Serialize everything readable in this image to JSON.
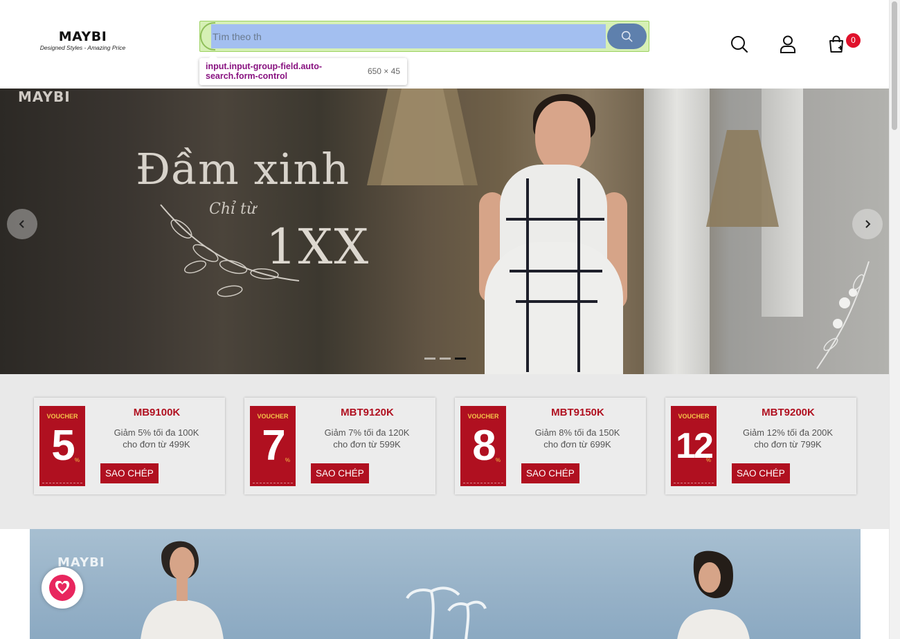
{
  "header": {
    "logo_brand": "MAYBI",
    "logo_tagline": "Designed Styles - Amazing Price",
    "search": {
      "placeholder": "Tìm theo th"
    },
    "cart_count": "0"
  },
  "devtools_tooltip": {
    "selector": "input.input-group-field.auto-search.form-control",
    "dimensions": "650 × 45"
  },
  "hero": {
    "brand": "MAYBI",
    "headline": "Đầm xinh",
    "subline": "Chỉ từ",
    "price": "1XX",
    "slides_total": 3,
    "active_slide": 3
  },
  "vouchers": [
    {
      "label": "VOUCHER",
      "percent": "5",
      "pct_sign": "%",
      "code": "MB9100K",
      "line1": "Giảm 5% tối đa 100K",
      "line2": "cho đơn từ 499K",
      "button": "SAO CHÉP"
    },
    {
      "label": "VOUCHER",
      "percent": "7",
      "pct_sign": "%",
      "code": "MBT9120K",
      "line1": "Giảm 7% tối đa 120K",
      "line2": "cho đơn từ 599K",
      "button": "SAO CHÉP"
    },
    {
      "label": "VOUCHER",
      "percent": "8",
      "pct_sign": "%",
      "code": "MBT9150K",
      "line1": "Giảm 8% tối đa 150K",
      "line2": "cho đơn từ 699K",
      "button": "SAO CHÉP"
    },
    {
      "label": "VOUCHER",
      "percent": "12",
      "pct_sign": "%",
      "code": "MBT9200K",
      "line1": "Giảm 12% tối đa 200K",
      "line2": "cho đơn từ 799K",
      "button": "SAO CHÉP"
    }
  ],
  "banner2": {
    "brand": "MAYBI"
  },
  "colors": {
    "accent": "#b01020",
    "badge": "#e0112b",
    "favorite": "#e8265e"
  },
  "icons": [
    "search-icon",
    "user-icon",
    "cart-icon",
    "chevron-left-icon",
    "chevron-right-icon",
    "heart-icon"
  ]
}
